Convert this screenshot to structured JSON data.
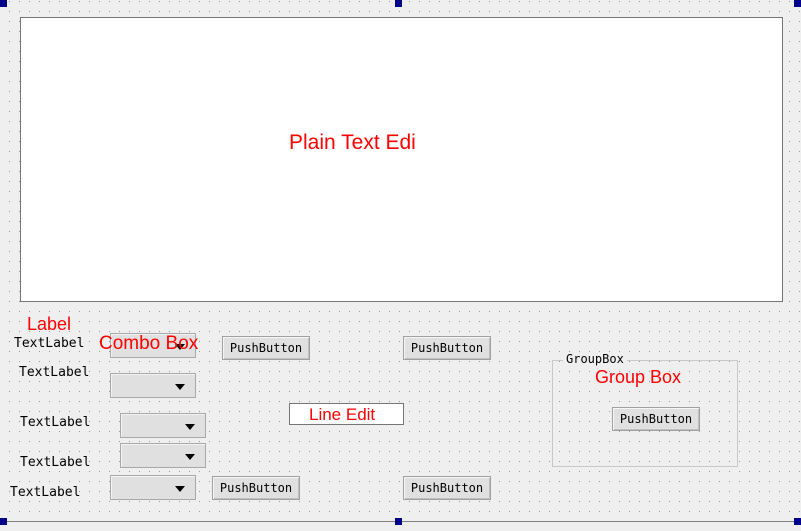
{
  "canvas": {
    "title": "Qt Designer Form Canvas",
    "background_color": "#efefef",
    "grid_dot_color": "#9a9a9a",
    "selection_handle_color": "#00008b",
    "annotation_color": "#ff0000"
  },
  "widgets": {
    "plain_text_edit": {
      "annotation": "Plain Text Edi",
      "background_color": "#ffffff"
    },
    "label_annotation": "Label",
    "combo_annotation": "Combo Box",
    "line_edit_annotation": "Line Edit",
    "group_box_annotation": "Group Box",
    "group_box_title": "GroupBox",
    "text_labels": [
      {
        "text": "TextLabel"
      },
      {
        "text": "TextLabel"
      },
      {
        "text": "TextLabel"
      },
      {
        "text": "TextLabel"
      },
      {
        "text": "TextLabel"
      }
    ],
    "push_buttons": [
      {
        "text": "PushButton"
      },
      {
        "text": "PushButton"
      },
      {
        "text": "PushButton"
      },
      {
        "text": "PushButton"
      },
      {
        "text": "PushButton"
      }
    ],
    "combo_boxes": [
      {
        "value": ""
      },
      {
        "value": ""
      },
      {
        "value": ""
      },
      {
        "value": ""
      },
      {
        "value": ""
      }
    ],
    "line_edit": {
      "value": ""
    }
  }
}
